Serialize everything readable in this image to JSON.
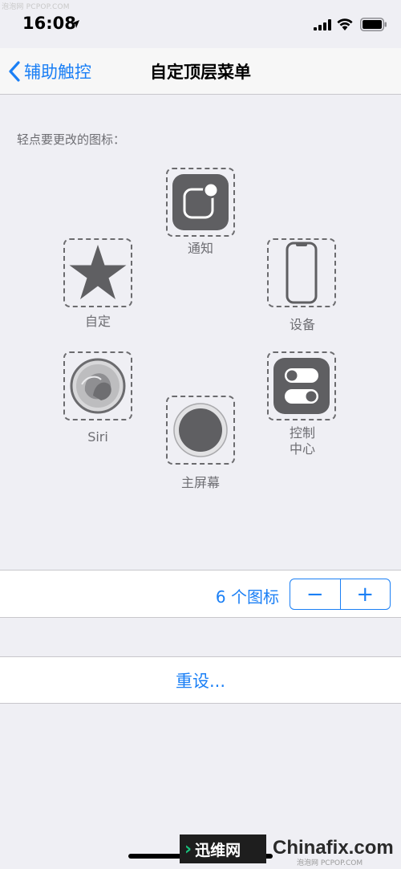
{
  "watermark_top": "泡泡网 PCPOP.COM",
  "status": {
    "time": "16:08"
  },
  "nav": {
    "back_label": "辅助触控",
    "title": "自定顶层菜单"
  },
  "hint": "轻点要更改的图标：",
  "slots": {
    "notification": {
      "label": "通知",
      "icon": "notification-icon"
    },
    "custom": {
      "label": "自定",
      "icon": "star-icon"
    },
    "device": {
      "label": "设备",
      "icon": "iphone-icon"
    },
    "siri": {
      "label": "Siri",
      "icon": "siri-icon"
    },
    "control_center_line1": "控制",
    "control_center_line2": "中心",
    "home": {
      "label": "主屏幕",
      "icon": "home-button-icon"
    }
  },
  "count": {
    "label": "6 个图标",
    "minus": "−",
    "plus": "+"
  },
  "reset_label": "重设...",
  "branding": {
    "badge": "迅维网",
    "site": "Chinafix.com",
    "sub": "泡泡网 PCPOP.COM"
  },
  "colors": {
    "accent": "#1a7ff5",
    "icon_dark": "#5f5f62",
    "background": "#efeff4"
  }
}
